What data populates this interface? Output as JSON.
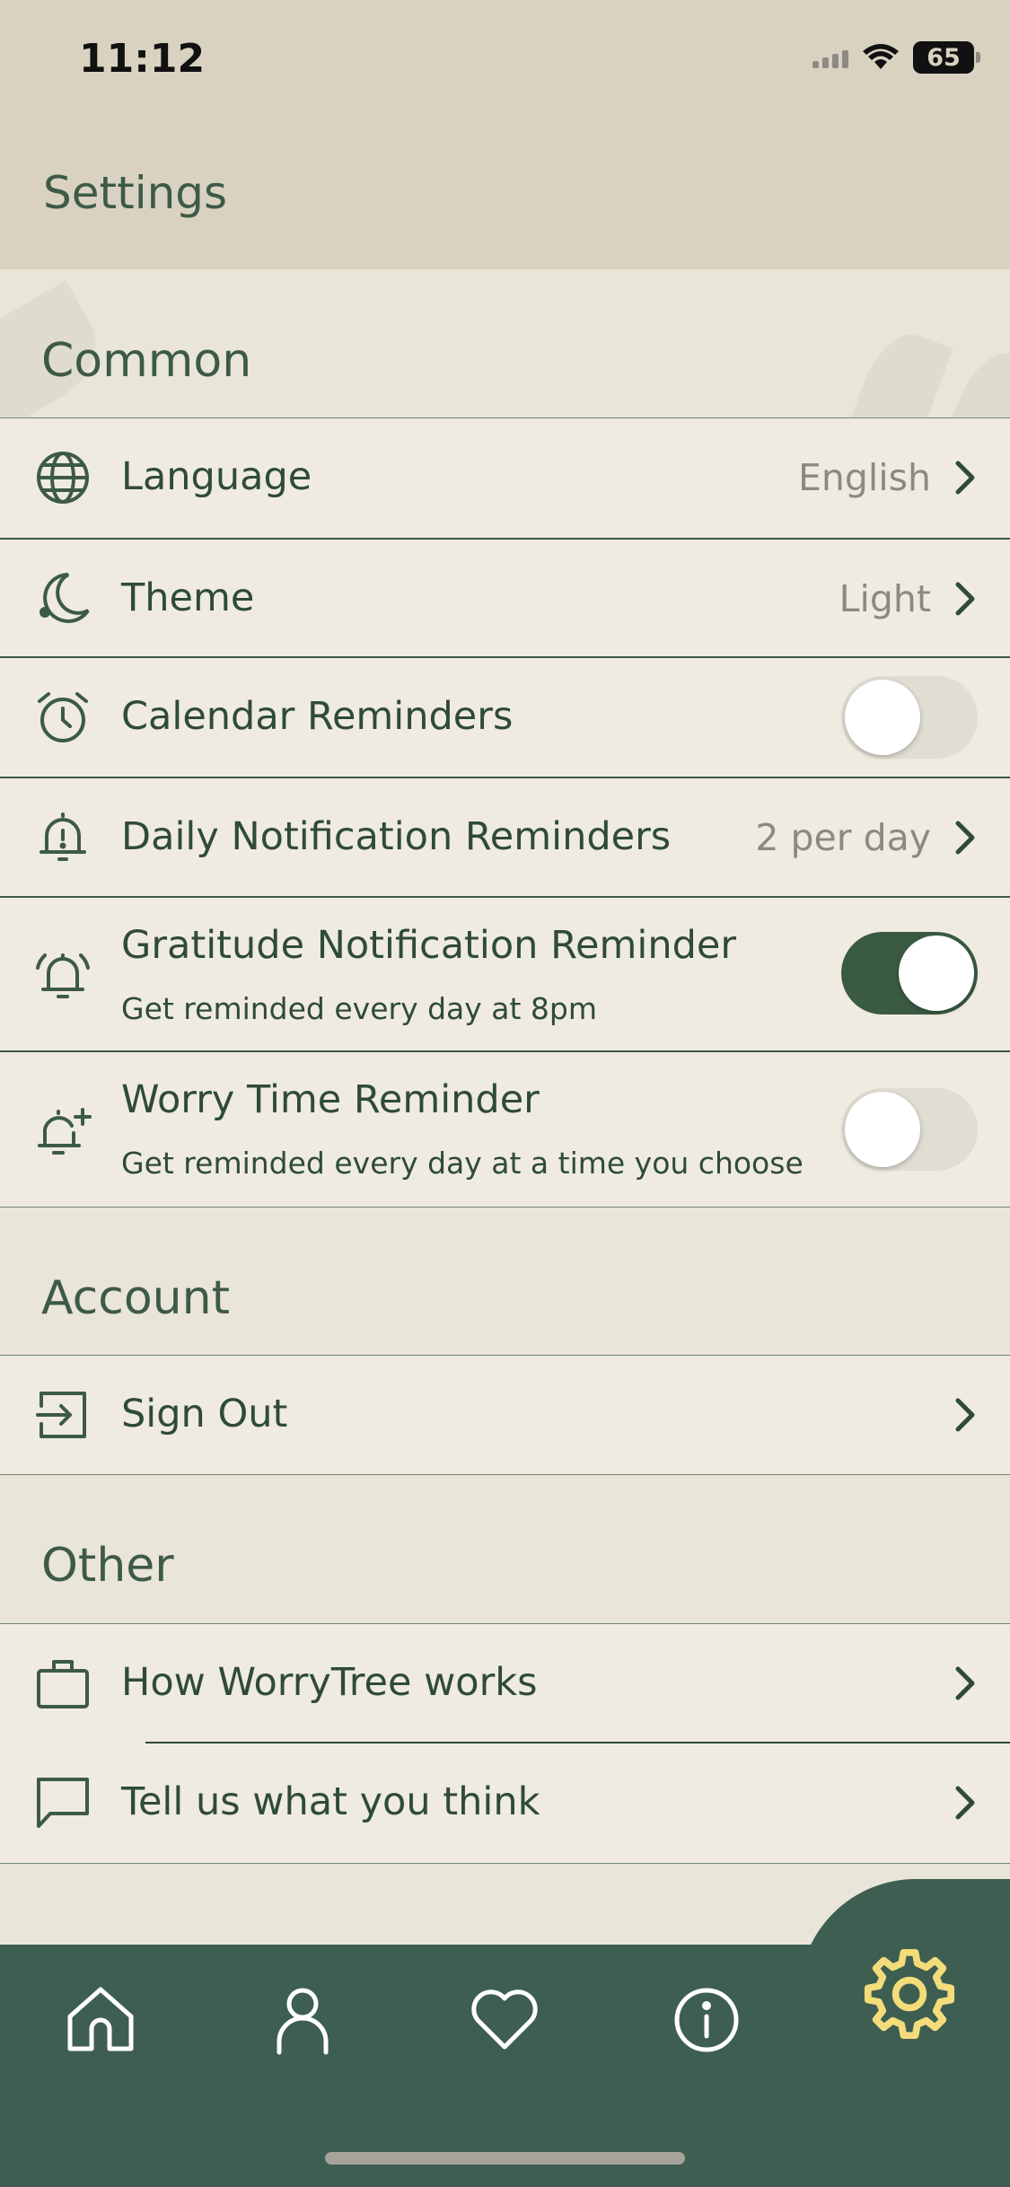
{
  "status_bar": {
    "time": "11:12",
    "battery": "65"
  },
  "header": {
    "title": "Settings"
  },
  "sections": {
    "common": {
      "title": "Common",
      "language": {
        "label": "Language",
        "value": "English"
      },
      "theme": {
        "label": "Theme",
        "value": "Light"
      },
      "calendar_reminders": {
        "label": "Calendar Reminders",
        "enabled": false
      },
      "daily_notifications": {
        "label": "Daily Notification Reminders",
        "value": "2 per day"
      },
      "gratitude_reminder": {
        "label": "Gratitude Notification Reminder",
        "subtitle": "Get reminded every day at 8pm",
        "enabled": true
      },
      "worry_time_reminder": {
        "label": "Worry Time Reminder",
        "subtitle": "Get reminded every day at a time you choose",
        "enabled": false
      }
    },
    "account": {
      "title": "Account",
      "sign_out": {
        "label": "Sign Out"
      }
    },
    "other": {
      "title": "Other",
      "how_it_works": {
        "label": "How WorryTree works"
      },
      "feedback": {
        "label": "Tell us what you think"
      }
    }
  },
  "tab_bar": {
    "items": [
      "home-icon",
      "profile-icon",
      "heart-icon",
      "info-icon",
      "gear-icon"
    ],
    "active": "gear-icon"
  },
  "colors": {
    "accent_dark_green": "#3e5e52",
    "text_green": "#2f4a3b",
    "active_tab_icon": "#f3dc7a",
    "background": "#e9e5d8"
  }
}
